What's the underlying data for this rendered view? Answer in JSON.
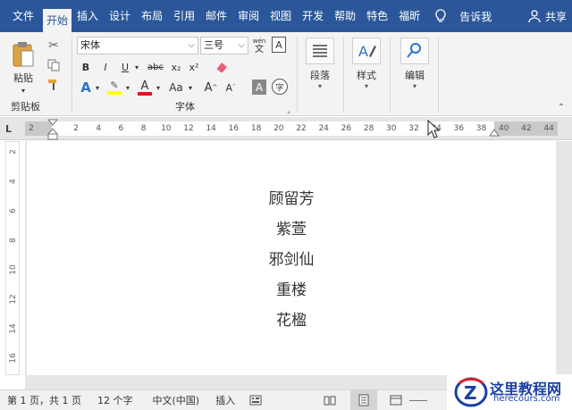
{
  "tabs": {
    "file": "文件",
    "home": "开始",
    "insert": "插入",
    "design": "设计",
    "layout": "布局",
    "references": "引用",
    "mailings": "邮件",
    "review": "审阅",
    "view": "视图",
    "developer": "开发",
    "help": "帮助",
    "special": "特色",
    "foxit": "福昕",
    "tell_me": "告诉我",
    "share": "共享"
  },
  "clipboard": {
    "paste_label": "粘贴",
    "group_label": "剪贴板"
  },
  "font": {
    "font_name": "宋体",
    "font_size": "三号",
    "bold": "B",
    "italic": "I",
    "underline": "U",
    "strike": "abc",
    "subscript": "x₂",
    "superscript": "x²",
    "change_case": "Aa",
    "grow": "A",
    "shrink": "A",
    "char_border": "A",
    "phonetic": "wén",
    "phonetic_char": "文",
    "enclose": "字",
    "group_label": "字体"
  },
  "paragraph": {
    "label": "段落"
  },
  "styles": {
    "label": "样式"
  },
  "editing": {
    "label": "编辑"
  },
  "ruler": {
    "numbers": [
      "2",
      "2",
      "4",
      "6",
      "8",
      "10",
      "12",
      "14",
      "16",
      "18",
      "20",
      "22",
      "24",
      "26",
      "28",
      "30",
      "32",
      "34",
      "36",
      "38",
      "40",
      "42",
      "44"
    ],
    "vertical_numbers": [
      "2",
      "4",
      "6",
      "8",
      "10",
      "12",
      "14",
      "16"
    ]
  },
  "document": {
    "lines": [
      "顾留芳",
      "紫萱",
      "邪剑仙",
      "重楼",
      "花楹"
    ]
  },
  "status": {
    "page": "第 1 页，共 1 页",
    "words": "12 个字",
    "language": "中文(中国)",
    "mode": "插入"
  },
  "watermark": {
    "title": "这里教程网",
    "url": "herecours.com"
  },
  "colors": {
    "accent": "#2b579a",
    "highlight": "#ffff00",
    "font_color": "#e81123"
  }
}
